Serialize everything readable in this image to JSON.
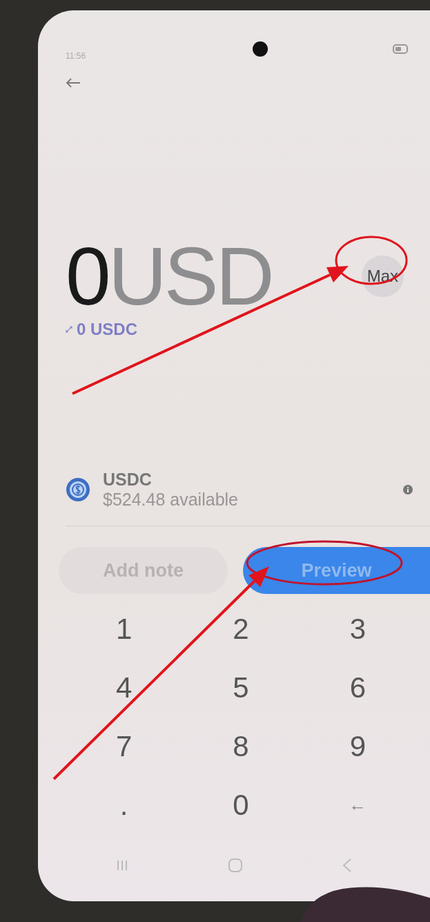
{
  "status_bar": {
    "time": "11:56"
  },
  "amount": {
    "value": "0",
    "currency": "USD"
  },
  "max_button": "Max",
  "converted": "0 USDC",
  "asset": {
    "name": "USDC",
    "available": "$524.48 available"
  },
  "buttons": [
    {
      "label": "Add note",
      "kind": "secondary"
    },
    {
      "label": "Preview",
      "kind": "primary"
    }
  ],
  "keypad": [
    "1",
    "2",
    "3",
    "4",
    "5",
    "6",
    "7",
    "8",
    "9",
    ".",
    "0",
    "←"
  ]
}
